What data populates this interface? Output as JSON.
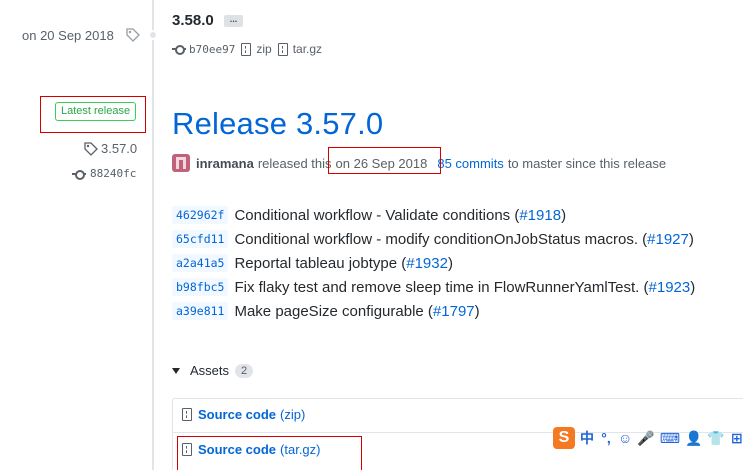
{
  "previous_release": {
    "date": "on 20 Sep 2018",
    "version": "3.58.0",
    "ellipsis": "...",
    "sha": "b70ee97",
    "zip_label": "zip",
    "targz_label": "tar.gz"
  },
  "release": {
    "badge": "Latest release",
    "tag": "3.57.0",
    "sha": "88240fc",
    "title": "Release 3.57.0",
    "author": "inramana",
    "released_text": "released this",
    "date": "on 26 Sep 2018",
    "commits_link": "85 commits",
    "commits_suffix": "to master since this release"
  },
  "commits": [
    {
      "sha": "462962f",
      "text": "Conditional workflow - Validate conditions (",
      "ref": "#1918",
      "end": ")"
    },
    {
      "sha": "65cfd11",
      "text": "Conditional workflow - modify conditionOnJobStatus macros. (",
      "ref": "#1927",
      "end": ")"
    },
    {
      "sha": "a2a41a5",
      "text": "Reportal tableau jobtype (",
      "ref": "#1932",
      "end": ")"
    },
    {
      "sha": "b98fbc5",
      "text": "Fix flaky test and remove sleep time in FlowRunnerYamlTest. (",
      "ref": "#1923",
      "end": ")"
    },
    {
      "sha": "a39e811",
      "text": "Make pageSize configurable (",
      "ref": "#1797",
      "end": ")"
    }
  ],
  "assets": {
    "label": "Assets",
    "count": "2",
    "items": [
      {
        "name": "Source code",
        "ext": "(zip)"
      },
      {
        "name": "Source code",
        "ext": "(tar.gz)"
      }
    ]
  },
  "ime": {
    "logo": "S",
    "items": [
      "中",
      "°,",
      "☺",
      "🎤",
      "⌨",
      "👤",
      "👕",
      "⊞"
    ]
  },
  "colors": {
    "link": "#0366d6",
    "badge_green": "#28a745",
    "highlight_red": "#d40000",
    "ime_orange": "#f47920"
  }
}
